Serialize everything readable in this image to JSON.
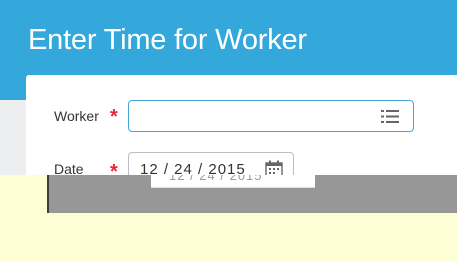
{
  "header": {
    "title": "Enter Time for Worker",
    "background_color": "#35a8db"
  },
  "form": {
    "worker": {
      "label": "Worker",
      "required_marker": "*",
      "value": "",
      "prompt_icon": "list-prompt-icon"
    },
    "date": {
      "label": "Date",
      "required_marker": "*",
      "value": "12 / 24 / 2015",
      "calendar_icon": "calendar-icon"
    }
  },
  "colors": {
    "accent": "#35a8db",
    "required": "#e5273c",
    "input_focus_border": "#4aa6d8",
    "redaction_gray": "#979797",
    "redaction_yellow": "#fdfed4"
  }
}
